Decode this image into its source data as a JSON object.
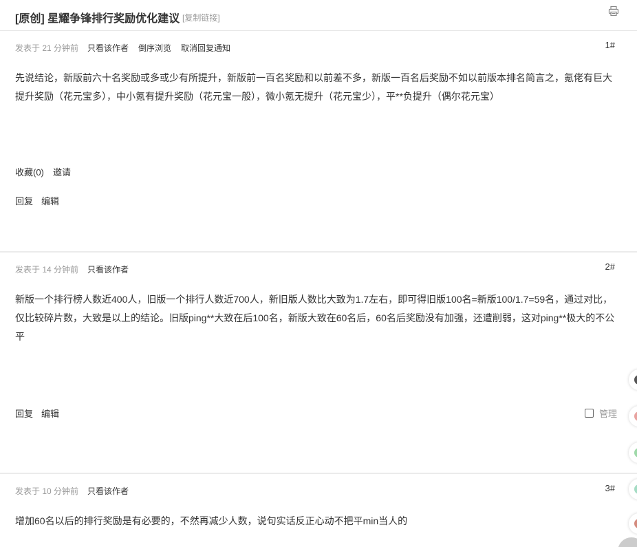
{
  "thread": {
    "title": "[原创] 星耀争锋排行奖励优化建议",
    "copy_link": "[复制链接]"
  },
  "actions": {
    "reply": "回复",
    "edit": "编辑",
    "favorite": "收藏(0)",
    "invite": "邀请",
    "manage": "管理"
  },
  "posts": [
    {
      "time": "发表于 21 分钟前",
      "links": [
        "只看该作者",
        "倒序浏览",
        "取消回复通知"
      ],
      "floor": "1#",
      "content": "先说结论，新版前六十名奖励或多或少有所提升，新版前一百名奖励和以前差不多，新版一百名后奖励不如以前版本排名简言之，氪佬有巨大提升奖励（花元宝多），中小氪有提升奖励（花元宝一般），微小氪无提升（花元宝少），平**负提升（偶尔花元宝）"
    },
    {
      "time": "发表于 14 分钟前",
      "links": [
        "只看该作者"
      ],
      "floor": "2#",
      "content": "新版一个排行榜人数近400人，旧版一个排行人数近700人，新旧版人数比大致为1.7左右，即可得旧版100名=新版100/1.7=59名，通过对比，仅比较碎片数，大致是以上的结论。旧版ping**大致在后100名，新版大致在60名后，60名后奖励没有加强，还遭削弱，这对ping**极大的不公平"
    },
    {
      "time": "发表于 10 分钟前",
      "links": [
        "只看该作者"
      ],
      "floor": "3#",
      "content": "增加60名以后的排行奖励是有必要的，不然再减少人数，说句实话反正心动不把平min当人的"
    }
  ],
  "side_colors": [
    "#555555",
    "#e8a3a0",
    "#9fd9a9",
    "#a5dcc4",
    "#d48b7e"
  ]
}
